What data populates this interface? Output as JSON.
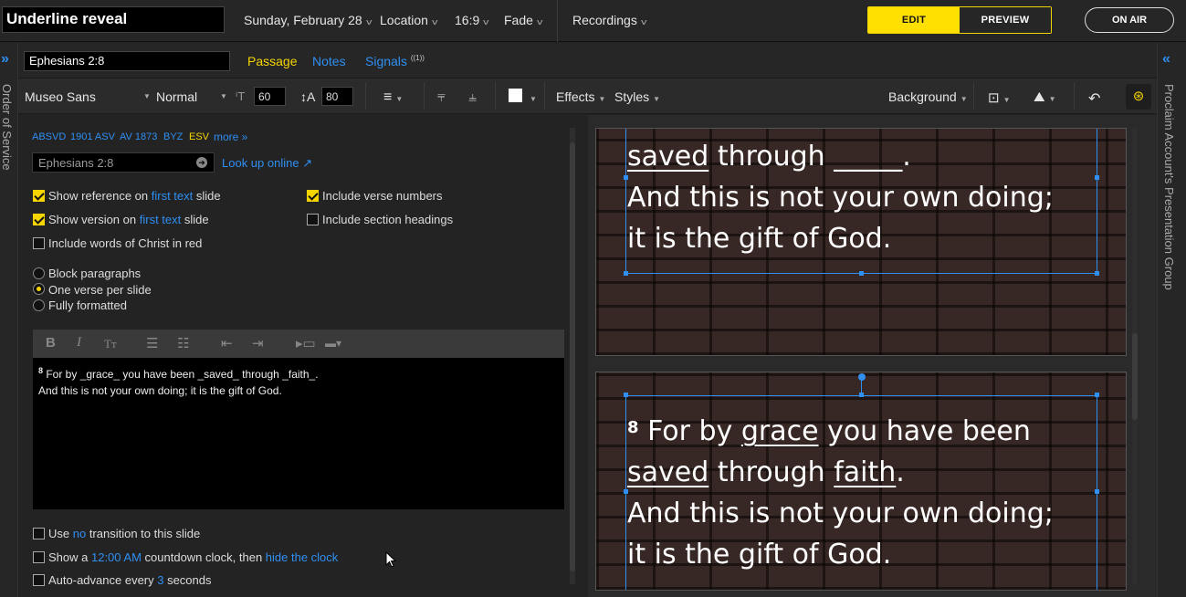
{
  "header": {
    "title": "Underline reveal",
    "date": "Sunday, February 28",
    "location": "Location",
    "aspect": "16:9",
    "transition": "Fade",
    "recordings": "Recordings",
    "edit_label": "EDIT",
    "preview_label": "PREVIEW",
    "on_air_label": "ON AIR"
  },
  "sidebars": {
    "left_label": "Order of Service",
    "right_label": "Proclaim Account's Presentation Group"
  },
  "tabs": {
    "reference": "Ephesians 2:8",
    "items": [
      {
        "label": "Passage"
      },
      {
        "label": "Notes"
      },
      {
        "label": "Signals"
      }
    ],
    "signals_badge": "((1))"
  },
  "toolbar": {
    "font": "Museo Sans",
    "weight": "Normal",
    "font_size": "60",
    "line_height": "80",
    "effects": "Effects",
    "styles": "Styles",
    "background": "Background"
  },
  "passage": {
    "versions": [
      "ABSVD",
      "1901 ASV",
      "AV 1873",
      "BYZ",
      "ESV"
    ],
    "more": "more »",
    "reference": "Ephesians 2:8",
    "lookup": "Look up online",
    "options": {
      "show_ref_a": "Show reference on ",
      "show_ref_link": "first text",
      "show_ref_b": " slide",
      "show_ver_a": "Show version on ",
      "show_ver_link": "first text",
      "show_ver_b": " slide",
      "words_red": "Include words of Christ in red",
      "verse_numbers": "Include verse numbers",
      "section_headings": "Include section headings"
    },
    "layouts": [
      "Block paragraphs",
      "One verse per slide",
      "Fully formatted"
    ],
    "editor_num": "8",
    "editor_line1": " For by _grace_ you have been _saved_ through _faith_.",
    "editor_line2": "And this is not your own doing; it is the gift of God.",
    "footer": {
      "use_a": "Use ",
      "use_link": "no",
      "use_b": " transition to this slide",
      "show_a": "Show a ",
      "show_link": "12:00 AM",
      "show_b": " countdown clock, then ",
      "show_link2": "hide the clock",
      "auto_a": "Auto-advance every ",
      "auto_link": "3",
      "auto_b": " seconds"
    }
  },
  "slides": {
    "s1": {
      "l1a": "saved",
      "l1b": " through ",
      "l1c": "_____",
      "l1d": ".",
      "l2": "And this is not your own doing;",
      "l3": "it is the gift of God."
    },
    "s2": {
      "num": "8",
      "l0a": " For by ",
      "l0b": "grace",
      "l0c": " you have been",
      "l1a": "saved",
      "l1b": " through ",
      "l1c": "faith",
      "l1d": ".",
      "l2": "And this is not your own doing;",
      "l3": "it is the gift of God."
    }
  }
}
